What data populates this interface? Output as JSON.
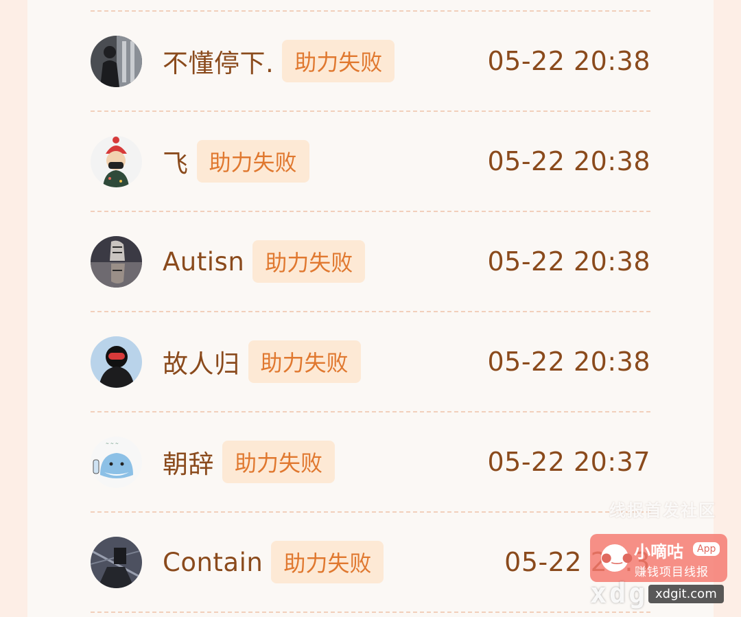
{
  "badge_label": "助力失败",
  "records": [
    {
      "name": "不懂停下.",
      "status": "助力失败",
      "time": "05-22 20:38",
      "avatar": "photo-avatar"
    },
    {
      "name": "飞",
      "status": "助力失败",
      "time": "05-22 20:38",
      "avatar": "cartoon-avatar"
    },
    {
      "name": "Autisn",
      "status": "助力失败",
      "time": "05-22 20:38",
      "avatar": "tiger-avatar"
    },
    {
      "name": "故人归",
      "status": "助力失败",
      "time": "05-22 20:38",
      "avatar": "skier-avatar"
    },
    {
      "name": "朝辞",
      "status": "助力失败",
      "time": "05-22 20:37",
      "avatar": "shark-avatar"
    },
    {
      "name": "Contain",
      "status": "助力失败",
      "time": "05-22 20:3",
      "avatar": "dark-avatar"
    }
  ],
  "watermark": {
    "top_text": "线报首发社区",
    "brand": "小嘀咕",
    "app_badge": "App",
    "tagline": "赚钱项目线报",
    "domain_big": "xdg",
    "domain_small": "xdgit.com"
  },
  "colors": {
    "background": "#fdeee6",
    "panel": "#fbf8f5",
    "text": "#8a4a1c",
    "badge_bg": "#fde9d5",
    "badge_text": "#e0782f",
    "divider": "#f1cfbb"
  }
}
